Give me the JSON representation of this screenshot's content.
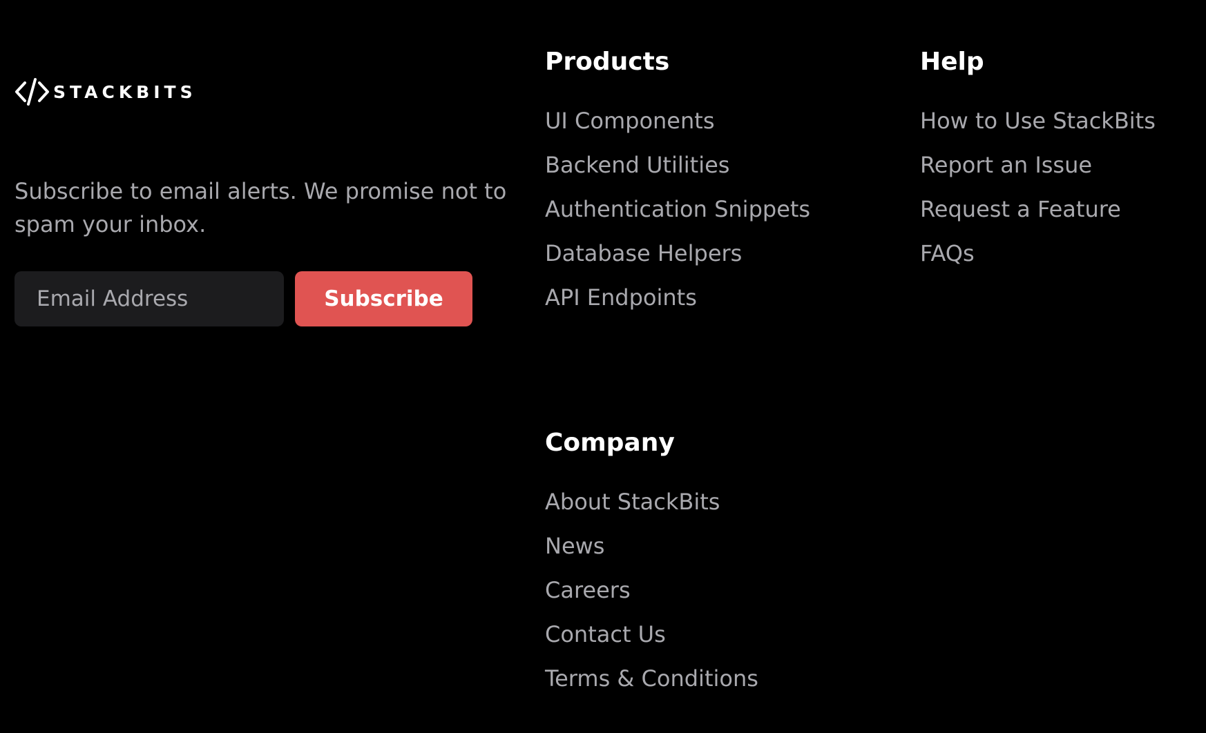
{
  "brand": {
    "logo_text": "STACKBITS",
    "logo_icon": "code-brackets-icon"
  },
  "subscribe": {
    "tagline": "Subscribe to email alerts. We promise not to spam your inbox.",
    "email_placeholder": "Email Address",
    "button_label": "Subscribe"
  },
  "columns": {
    "products": {
      "heading": "Products",
      "links": [
        "UI Components",
        "Backend Utilities",
        "Authentication Snippets",
        "Database Helpers",
        "API Endpoints"
      ]
    },
    "help": {
      "heading": "Help",
      "links": [
        "How to Use StackBits",
        "Report an Issue",
        "Request a Feature",
        "FAQs"
      ]
    },
    "company": {
      "heading": "Company",
      "links": [
        "About StackBits",
        "News",
        "Careers",
        "Contact Us",
        "Terms & Conditions"
      ]
    }
  },
  "colors": {
    "background": "#000000",
    "heading": "#ffffff",
    "link": "#a9a9ae",
    "input_bg": "#1c1c1e",
    "accent": "#e05452"
  }
}
